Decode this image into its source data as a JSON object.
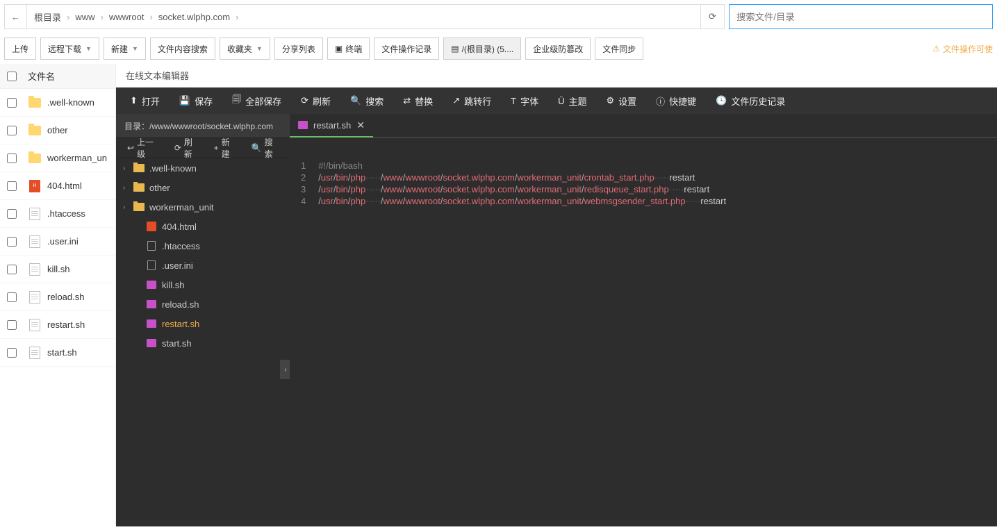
{
  "breadcrumb": {
    "root": "根目录",
    "p1": "www",
    "p2": "wwwroot",
    "p3": "socket.wlphp.com"
  },
  "search": {
    "placeholder": "搜索文件/目录"
  },
  "toolbar": {
    "upload": "上传",
    "remote_dl": "远程下载",
    "new": "新建",
    "content_search": "文件内容搜索",
    "favorites": "收藏夹",
    "share_list": "分享列表",
    "terminal": "终端",
    "op_log": "文件操作记录",
    "root_disk": "/(根目录) (5....",
    "tamper": "企业级防篡改",
    "sync": "文件同步",
    "warn": "文件操作可使"
  },
  "list_header": "文件名",
  "files": [
    {
      "name": ".well-known",
      "type": "folder"
    },
    {
      "name": "other",
      "type": "folder"
    },
    {
      "name": "workerman_un",
      "type": "folder"
    },
    {
      "name": "404.html",
      "type": "html"
    },
    {
      "name": ".htaccess",
      "type": "doc"
    },
    {
      "name": ".user.ini",
      "type": "doc"
    },
    {
      "name": "kill.sh",
      "type": "doc"
    },
    {
      "name": "reload.sh",
      "type": "doc"
    },
    {
      "name": "restart.sh",
      "type": "doc"
    },
    {
      "name": "start.sh",
      "type": "doc"
    }
  ],
  "editor": {
    "title": "在线文本编辑器",
    "btn_open": "打开",
    "btn_save": "保存",
    "btn_save_all": "全部保存",
    "btn_refresh": "刷新",
    "btn_search": "搜索",
    "btn_replace": "替换",
    "btn_goto": "跳转行",
    "btn_font": "字体",
    "btn_theme": "主题",
    "btn_settings": "设置",
    "btn_shortcut": "快捷键",
    "btn_history": "文件历史记录",
    "path_label": "目录：/www/wwwroot/socket.wlphp.com",
    "sub_up": "上一级",
    "sub_refresh": "刷新",
    "sub_new": "新建",
    "sub_search": "搜索",
    "tab_name": "restart.sh"
  },
  "tree": [
    {
      "name": ".well-known",
      "type": "folder",
      "depth": 0
    },
    {
      "name": "other",
      "type": "folder",
      "depth": 0
    },
    {
      "name": "workerman_unit",
      "type": "folder",
      "depth": 0
    },
    {
      "name": "404.html",
      "type": "html",
      "depth": 1
    },
    {
      "name": ".htaccess",
      "type": "doc",
      "depth": 1
    },
    {
      "name": ".user.ini",
      "type": "doc",
      "depth": 1
    },
    {
      "name": "kill.sh",
      "type": "sh",
      "depth": 1
    },
    {
      "name": "reload.sh",
      "type": "sh",
      "depth": 1
    },
    {
      "name": "restart.sh",
      "type": "sh",
      "depth": 1,
      "active": true
    },
    {
      "name": "start.sh",
      "type": "sh",
      "depth": 1
    }
  ],
  "code": {
    "line1": "#!/bin/bash",
    "segs": [
      "usr",
      "bin",
      "php"
    ],
    "mid": [
      "www",
      "wwwroot",
      "socket.wlphp.com",
      "workerman_unit"
    ],
    "f2": "crontab_start.php",
    "f3": "redisqueue_start.php",
    "f4": "webmsgsender_start.php",
    "restart": "restart"
  }
}
